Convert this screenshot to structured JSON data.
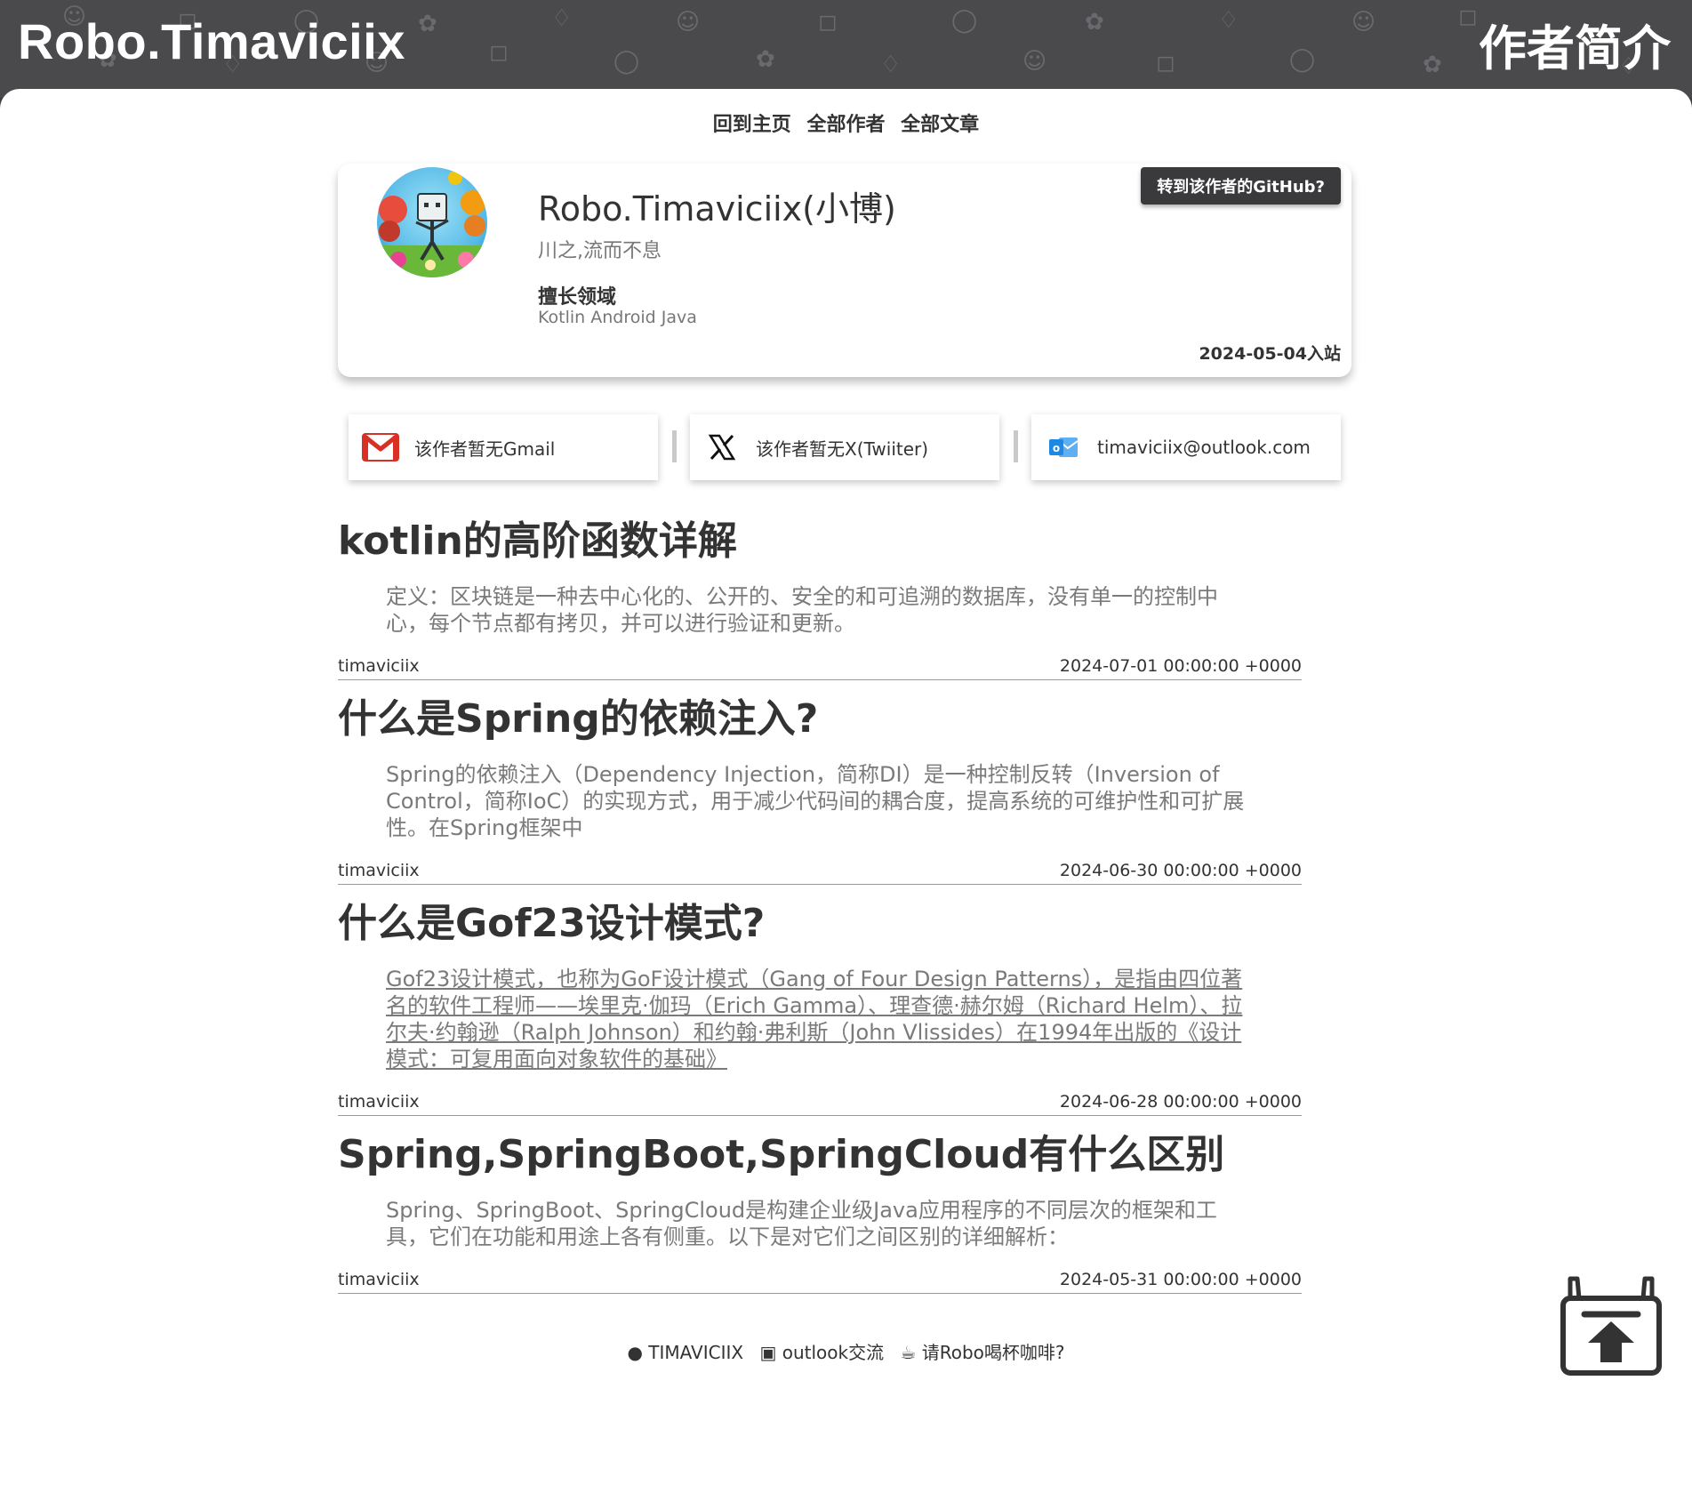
{
  "header": {
    "site_title": "Robo.Timaviciix",
    "page_label": "作者简介"
  },
  "nav": {
    "items": [
      "回到主页",
      "全部作者",
      "全部文章"
    ]
  },
  "profile": {
    "name": "Robo.Timaviciix(小博)",
    "motto": "川之,流而不息",
    "expertise_title": "擅长领域",
    "expertise_value": "Kotlin Android Java",
    "github_button": "转到该作者的GitHub?",
    "join_date": "2024-05-04入站"
  },
  "contacts": [
    {
      "icon": "gmail-icon",
      "label": "该作者暂无Gmail"
    },
    {
      "icon": "x-twitter-icon",
      "label": "该作者暂无X(Twiiter)"
    },
    {
      "icon": "outlook-icon",
      "label": "timaviciix@outlook.com"
    }
  ],
  "articles": [
    {
      "title": "kotlin的高阶函数详解",
      "summary": "定义：区块链是一种去中心化的、公开的、安全的和可追溯的数据库，没有单一的控制中心，每个节点都有拷贝，并可以进行验证和更新。",
      "author": "timaviciix",
      "date": "2024-07-01 00:00:00 +0000"
    },
    {
      "title": "什么是Spring的依赖注入?",
      "summary": "Spring的依赖注入（Dependency Injection，简称DI）是一种控制反转（Inversion of Control，简称IoC）的实现方式，用于减少代码间的耦合度，提高系统的可维护性和可扩展性。在Spring框架中",
      "author": "timaviciix",
      "date": "2024-06-30 00:00:00 +0000"
    },
    {
      "title": "什么是Gof23设计模式?",
      "summary": "Gof23设计模式，也称为GoF设计模式（Gang of Four Design Patterns），是指由四位著名的软件工程师——埃里克·伽玛（Erich Gamma）、理查德·赫尔姆（Richard Helm）、拉尔夫·约翰逊（Ralph Johnson）和约翰·弗利斯（John Vlissides）在1994年出版的《设计模式：可复用面向对象软件的基础》",
      "author": "timaviciix",
      "date": "2024-06-28 00:00:00 +0000"
    },
    {
      "title": "Spring,SpringBoot,SpringCloud有什么区别",
      "summary": "Spring、SpringBoot、SpringCloud是构建企业级Java应用程序的不同层次的框架和工具，它们在功能和用途上各有侧重。以下是对它们之间区别的详细解析：",
      "author": "timaviciix",
      "date": "2024-05-31 00:00:00 +0000"
    }
  ],
  "footer": {
    "github": "TIMAVICIIX",
    "outlook": "outlook交流",
    "coffee": "请Robo喝杯咖啡?"
  },
  "colors": {
    "header_bg": "#4a4a4d",
    "github_button_bg": "#3a3a3c",
    "gmail_red": "#d93025",
    "outlook_blue": "#1e88e5"
  }
}
